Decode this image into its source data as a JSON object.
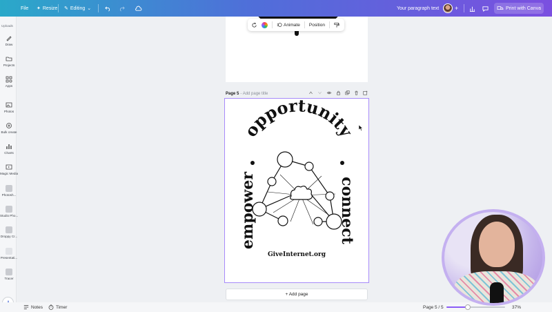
{
  "topbar": {
    "file": "File",
    "resize": "Resize",
    "editing": "Editing",
    "doc_title": "Your paragraph text",
    "print": "Print with Canva"
  },
  "rail": {
    "header": "Uploads",
    "items": [
      {
        "label": "Draw",
        "icon": "draw-icon"
      },
      {
        "label": "Projects",
        "icon": "folder-icon"
      },
      {
        "label": "Apps",
        "icon": "apps-icon"
      },
      {
        "label": "Photos",
        "icon": "photos-icon"
      },
      {
        "label": "Bulk create",
        "icon": "bulk-create-icon"
      },
      {
        "label": "Charts",
        "icon": "charts-icon"
      },
      {
        "label": "Magic Media",
        "icon": "magic-media-icon"
      },
      {
        "label": "Photosh...",
        "icon": "app-thumbnail"
      },
      {
        "label": "Studio Pho...",
        "icon": "app-thumbnail"
      },
      {
        "label": "Droppy Cr...",
        "icon": "app-thumbnail"
      },
      {
        "label": "Presentati...",
        "icon": "app-thumbnail"
      },
      {
        "label": "Tracer",
        "icon": "app-thumbnail"
      }
    ]
  },
  "float_toolbar": {
    "animate": "Animate",
    "position": "Position"
  },
  "page5": {
    "title": "Page 5",
    "subtitle": "- Add page title",
    "art": {
      "top_word": "opportunity",
      "left_word": "empower",
      "right_word": "connect",
      "footer": "GiveInternet.org"
    }
  },
  "add_page": "+ Add page",
  "bottombar": {
    "notes": "Notes",
    "timer": "Timer",
    "page_indicator": "Page 5 / 5",
    "zoom": "37%",
    "zoom_fraction": 0.37
  },
  "colors": {
    "accent": "#8b5cf6",
    "topbar_start": "#2aa9c9",
    "topbar_end": "#7b4fe0"
  }
}
